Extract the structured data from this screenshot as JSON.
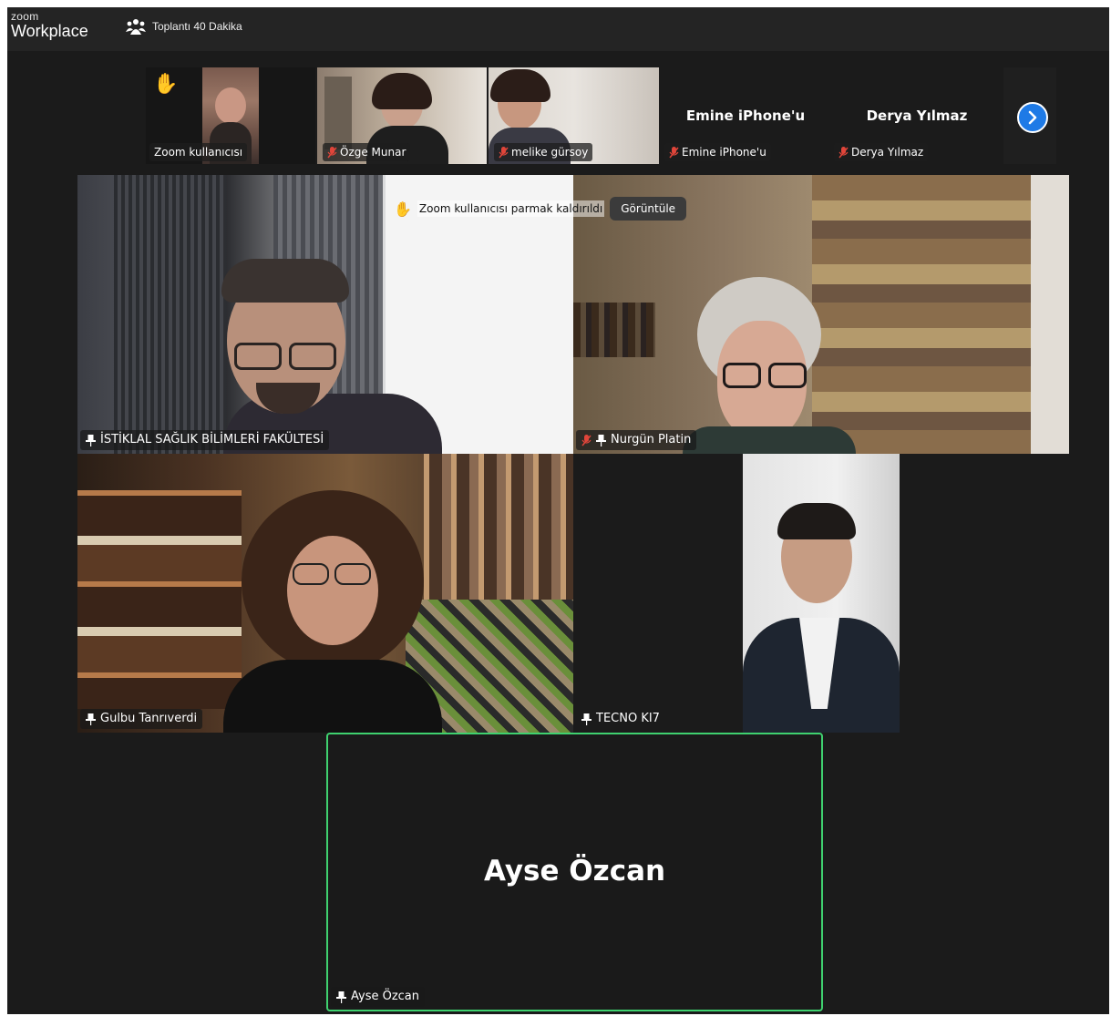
{
  "app": {
    "logo_top": "zoom",
    "logo_bottom": "Workplace",
    "meeting_title": "Toplantı 40 Dakika"
  },
  "filmstrip": [
    {
      "name": "Zoom kullanıcısı",
      "muted": false,
      "video": true,
      "hand_raised": true
    },
    {
      "name": "Özge Munar",
      "muted": true,
      "video": true
    },
    {
      "name": "melike gürsoy",
      "muted": true,
      "video": true
    },
    {
      "name": "Emine iPhone'u",
      "display_name": "Emine iPhone'u",
      "muted": true,
      "video": false
    },
    {
      "name": "Derya Yılmaz",
      "display_name": "Derya Yılmaz",
      "muted": true,
      "video": false
    }
  ],
  "notice": {
    "text": "Zoom kullanıcısı parmak kaldırıldı",
    "button": "Görüntüle"
  },
  "gallery": [
    {
      "name": "İSTİKLAL SAĞLIK BİLİMLERİ FAKÜLTESİ",
      "muted": false,
      "pinned": true
    },
    {
      "name": "Nurgün Platin",
      "muted": true,
      "pinned": true
    },
    {
      "name": "Gulbu Tanrıverdi",
      "muted": false,
      "pinned": true
    },
    {
      "name": "TECNO KI7",
      "muted": false,
      "pinned": true
    }
  ],
  "active_speaker": {
    "name": "Ayse Özcan",
    "label": "Ayse Özcan",
    "highlight_color": "#3fd16f"
  },
  "colors": {
    "background": "#1b1b1b",
    "titlebar": "#242424",
    "accent": "#1e7ae6",
    "mute": "#e0453a"
  }
}
